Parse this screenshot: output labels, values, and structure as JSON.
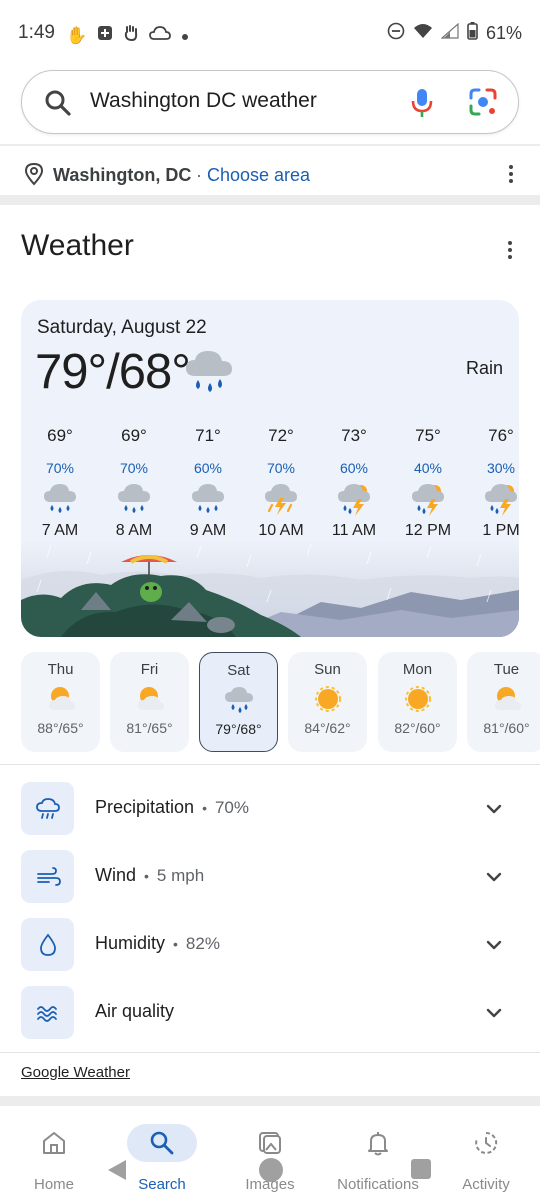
{
  "status_bar": {
    "time": "1:49",
    "battery": "61%",
    "left_icons": [
      "hand-icon",
      "plus-badge-icon",
      "hand-wave-icon",
      "cloud-icon",
      "dot-icon"
    ],
    "right_icons": [
      "dnd-icon",
      "wifi-icon",
      "signal-icon",
      "battery-icon"
    ]
  },
  "search": {
    "query": "Washington DC weather",
    "icons": [
      "search-icon",
      "mic-icon",
      "lens-icon"
    ]
  },
  "location": {
    "name": "Washington, DC",
    "separator": "·",
    "choose_area": "Choose area"
  },
  "weather": {
    "title": "Weather",
    "date": "Saturday, August 22",
    "high_low": "79°/68°",
    "condition": "Rain",
    "hourly": [
      {
        "temp": "69°",
        "precip": "70%",
        "time": "7 AM",
        "icon": "rain"
      },
      {
        "temp": "69°",
        "precip": "70%",
        "time": "8 AM",
        "icon": "rain"
      },
      {
        "temp": "71°",
        "precip": "60%",
        "time": "9 AM",
        "icon": "rain"
      },
      {
        "temp": "72°",
        "precip": "70%",
        "time": "10 AM",
        "icon": "thunder"
      },
      {
        "temp": "73°",
        "precip": "60%",
        "time": "11 AM",
        "icon": "thunder-rain"
      },
      {
        "temp": "75°",
        "precip": "40%",
        "time": "12 PM",
        "icon": "thunder-rain"
      },
      {
        "temp": "76°",
        "precip": "30%",
        "time": "1 PM",
        "icon": "thunder-rain"
      }
    ],
    "daily": [
      {
        "day": "Thu",
        "temps": "88°/65°",
        "icon": "partly-sunny"
      },
      {
        "day": "Fri",
        "temps": "81°/65°",
        "icon": "partly-sunny"
      },
      {
        "day": "Sat",
        "temps": "79°/68°",
        "icon": "rain",
        "selected": true
      },
      {
        "day": "Sun",
        "temps": "84°/62°",
        "icon": "sunny"
      },
      {
        "day": "Mon",
        "temps": "82°/60°",
        "icon": "sunny"
      },
      {
        "day": "Tue",
        "temps": "81°/60°",
        "icon": "partly-sunny"
      }
    ],
    "details": [
      {
        "label": "Precipitation",
        "value": "70%",
        "icon": "rain-cloud-icon"
      },
      {
        "label": "Wind",
        "value": "5 mph",
        "icon": "wind-icon"
      },
      {
        "label": "Humidity",
        "value": "82%",
        "icon": "droplet-icon"
      },
      {
        "label": "Air quality",
        "value": "",
        "icon": "air-quality-icon"
      }
    ],
    "source_link": "Google Weather"
  },
  "colors": {
    "accent_blue": "#1a5fb4",
    "card_bg": "#eef2fa",
    "sun": "#f9a825"
  },
  "bottom_nav": [
    {
      "label": "Home",
      "icon": "home-icon"
    },
    {
      "label": "Search",
      "icon": "search-icon",
      "active": true
    },
    {
      "label": "Images",
      "icon": "images-icon"
    },
    {
      "label": "Notifications",
      "icon": "bell-icon"
    },
    {
      "label": "Activity",
      "icon": "activity-icon"
    }
  ]
}
